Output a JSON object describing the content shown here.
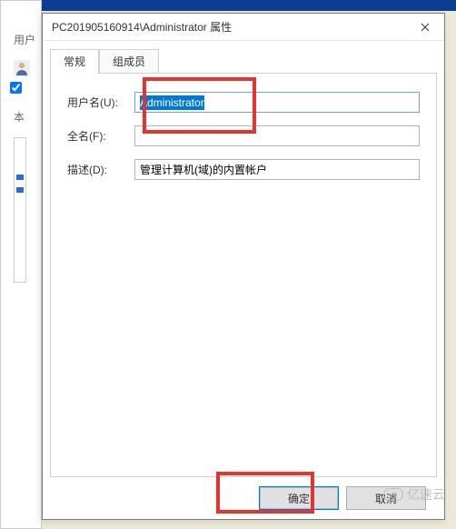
{
  "background": {
    "partial_label_1": "用户",
    "partial_label_2": "本",
    "checkbox_state": true,
    "watermark": "亿速云"
  },
  "dialog": {
    "title": "PC201905160914\\Administrator 属性",
    "tabs": [
      {
        "id": "general",
        "label": "常规",
        "active": true
      },
      {
        "id": "members",
        "label": "组成员",
        "active": false
      }
    ],
    "fields": {
      "username_label": "用户名(U):",
      "username_value": "Administrator",
      "fullname_label": "全名(F):",
      "fullname_value": "",
      "description_label": "描述(D):",
      "description_value": "管理计算机(域)的内置帐户"
    },
    "buttons": {
      "ok": "确定",
      "cancel": "取消"
    }
  }
}
